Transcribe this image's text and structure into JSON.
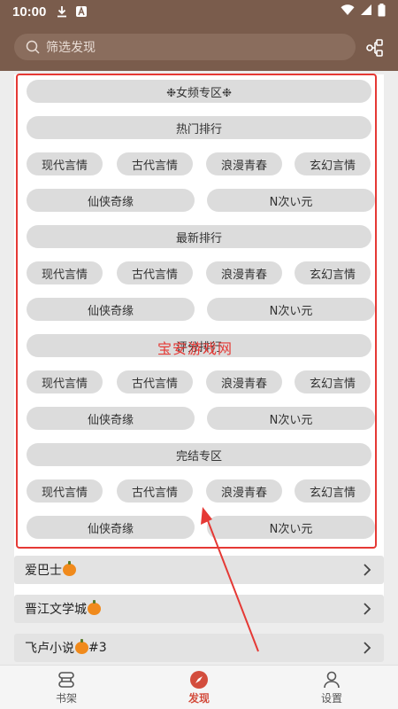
{
  "status": {
    "time": "10:00"
  },
  "search": {
    "placeholder": "筛选发现"
  },
  "section": {
    "title": "❉女频专区❉",
    "hot": "热门排行",
    "latest": "最新排行",
    "rating": "评分排行",
    "completed": "完结专区"
  },
  "genres": {
    "modern": "现代言情",
    "ancient": "古代言情",
    "romance": "浪漫青春",
    "fantasy": "玄幻言情",
    "xianxia": "仙侠奇缘",
    "ncigen": "N次い元"
  },
  "watermark": "宝安游戏网",
  "sources": [
    {
      "label": "爱巴士"
    },
    {
      "label": "晋江文学城"
    },
    {
      "label": "飞卢小说",
      "suffix": "#3"
    }
  ],
  "nav": {
    "bookshelf": "书架",
    "discover": "发现",
    "settings": "设置"
  },
  "colors": {
    "header": "#7a5c4c",
    "accent": "#d34d3d",
    "highlight": "#e53935"
  }
}
